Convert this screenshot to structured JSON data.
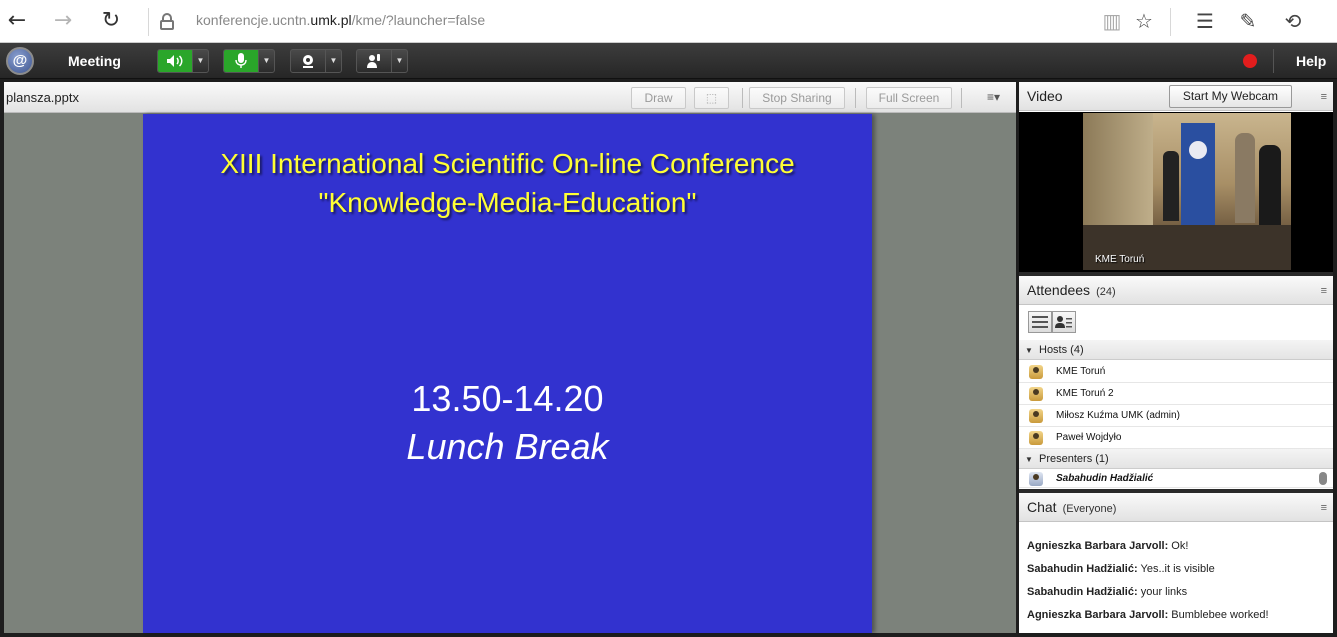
{
  "browser": {
    "url_prefix": "konferencje.ucntn.",
    "url_domain": "umk.pl",
    "url_suffix": "/kme/?launcher=false",
    "icons": [
      "back-icon",
      "forward-icon",
      "refresh-icon",
      "lock-icon",
      "reading-view-icon",
      "favorite-star-icon",
      "hub-icon",
      "web-note-icon",
      "share-icon"
    ]
  },
  "appbar": {
    "logo": "@",
    "meeting_label": "Meeting",
    "help_label": "Help",
    "controls": [
      "speaker-control",
      "microphone-control",
      "webcam-control",
      "raise-hand-control"
    ],
    "active_green": "#2aa62a",
    "record_color": "#e21d1d"
  },
  "share": {
    "filename": "plansza.pptx",
    "draw_label": "Draw",
    "stop_sharing_label": "Stop Sharing",
    "full_screen_label": "Full Screen",
    "pod_menu": "≡▾",
    "slide": {
      "title_line1": "XIII International Scientific On-line Conference",
      "title_line2": "\"Knowledge-Media-Education\"",
      "time": "13.50-14.20",
      "caption": "Lunch Break",
      "background": "#3232cf",
      "title_color": "#ffff33"
    }
  },
  "video": {
    "title": "Video",
    "webcam_button": "Start My Webcam",
    "feed_label": "KME Toruń"
  },
  "attendees": {
    "title": "Attendees",
    "count": "(24)",
    "hosts_label": "Hosts (4)",
    "hosts": [
      "KME Toruń",
      "KME Toruń 2",
      "Miłosz Kuźma UMK (admin)",
      "Paweł Wojdyło"
    ],
    "presenters_label": "Presenters (1)",
    "presenters": [
      "Sabahudin  Hadžialić"
    ]
  },
  "chat": {
    "title": "Chat",
    "scope": "(Everyone)",
    "messages": [
      {
        "who": "Agnieszka Barbara Jarvoll:",
        "text": "Ok!"
      },
      {
        "who": "Sabahudin  Hadžialić:",
        "text": "Yes..it is visible"
      },
      {
        "who": "Sabahudin  Hadžialić:",
        "text": "your links"
      },
      {
        "who": "Agnieszka Barbara Jarvoll:",
        "text": "Bumblebee worked!"
      }
    ]
  }
}
